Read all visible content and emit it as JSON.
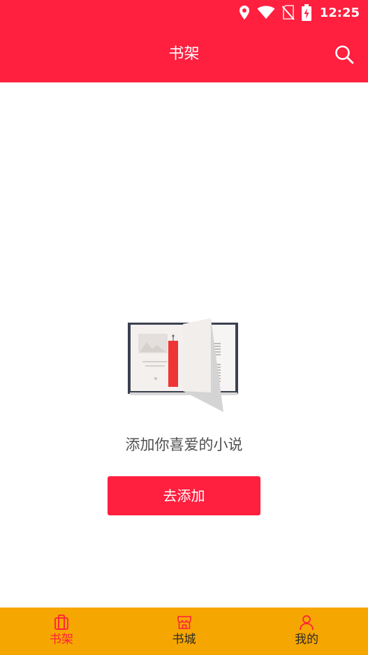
{
  "status_bar": {
    "time": "12:25",
    "icons": [
      "location-icon",
      "wifi-icon",
      "no-sim-icon",
      "battery-charging-icon"
    ]
  },
  "header": {
    "title": "书架",
    "search_icon": "search-icon"
  },
  "empty_state": {
    "illustration": "open-book-icon",
    "message": "添加你喜爱的小说",
    "button_label": "去添加"
  },
  "tabs": [
    {
      "label": "书架",
      "icon": "bookshelf-icon",
      "active": true
    },
    {
      "label": "书城",
      "icon": "store-icon",
      "active": false
    },
    {
      "label": "我的",
      "icon": "person-icon",
      "active": false
    }
  ],
  "colors": {
    "primary": "#ff1f3f",
    "tabbar": "#f6a600",
    "text_dark": "#2b2b2b",
    "text_gray": "#4f4f4f"
  }
}
